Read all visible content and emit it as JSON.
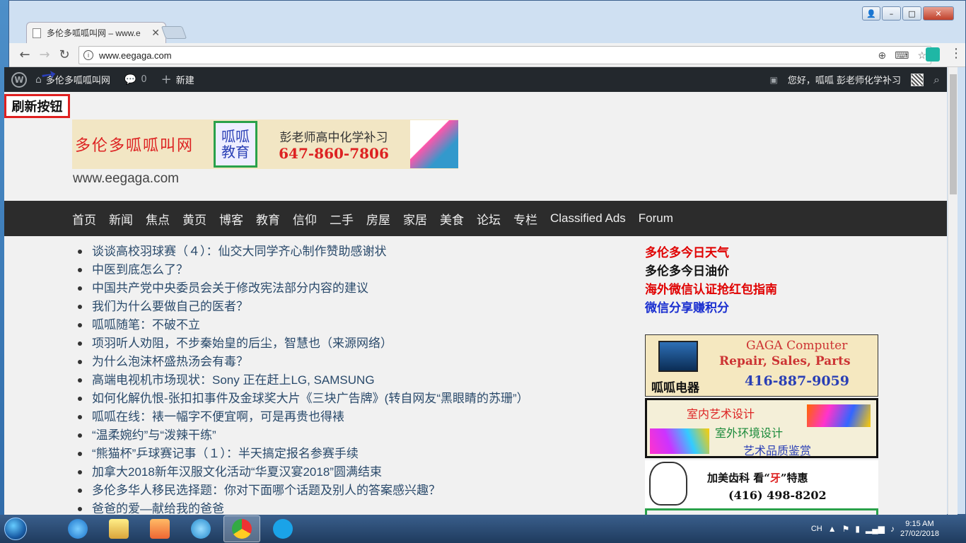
{
  "browser": {
    "tab_title": "多伦多呱呱叫网 – www.e",
    "url": "www.eegaga.com",
    "win_min": "–",
    "win_max": "□",
    "win_close": "✕"
  },
  "adminbar": {
    "site_name": "多伦多呱呱叫网",
    "comments_count": "0",
    "new_label": "新建",
    "greeting": "您好，呱呱 彭老师化学补习"
  },
  "annotation": {
    "refresh_label": "刷新按钮"
  },
  "banner": {
    "left_text": "多伦多呱呱叫网",
    "box_text": "呱呱教育",
    "line1": "彭老师高中化学补习",
    "phone": "647-860-7806"
  },
  "site_url": "www.eegaga.com",
  "mainnav": [
    "首页",
    "新闻",
    "焦点",
    "黄页",
    "博客",
    "教育",
    "信仰",
    "二手",
    "房屋",
    "家居",
    "美食",
    "论坛",
    "专栏",
    "Classified Ads",
    "Forum"
  ],
  "posts": [
    "谈谈高校羽球赛（４）：仙交大同学齐心制作赞助感谢状",
    "中医到底怎么了？",
    "中国共产党中央委员会关于修改宪法部分内容的建议",
    "我们为什么要做自己的医者？",
    "呱呱随笔：不破不立",
    "项羽听人劝阻，不步秦始皇的后尘，智慧也（来源网络）",
    "为什么泡沫杯盛热汤会有毒？",
    "高端电视机市场现状：Sony 正在赶上LG, SAMSUNG",
    "如何化解仇恨-张扣扣事件及金球奖大片《三块广告牌》(转自网友“黑眼睛的苏珊”）",
    "呱呱在线：裱一幅字不便宜啊，可是再贵也得裱",
    "“温柔婉约”与“泼辣干练”",
    "“熊猫杯”乒球赛记事（１）：半天搞定报名参赛手续",
    "加拿大2018新年汉服文化活动“华夏汉宴2018”圆满结束",
    "多伦多华人移民选择题：你对下面哪个话题及别人的答案感兴趣？",
    "爸爸的爱—献给我的爸爸"
  ],
  "sidelinks": [
    {
      "text": "多伦多今日天气",
      "color": "#e00000"
    },
    {
      "text": "多伦多今日油价",
      "color": "#111111"
    },
    {
      "text": "海外微信认证抢红包指南",
      "color": "#e00000"
    },
    {
      "text": "微信分享赚积分",
      "color": "#1a2fd0"
    }
  ],
  "ads": {
    "computer_l1": "GAGA Computer",
    "computer_l2": "Repair, Sales, Parts",
    "computer_l3": "呱呱电器",
    "computer_phone": "416-887-9059",
    "design_l1": "室内艺术设计",
    "design_l2": "室外环境设计",
    "design_l3": "艺术品质鉴赏",
    "dental_pre": "加美齿科 看“",
    "dental_mid": "牙",
    "dental_post": "”特惠",
    "dental_phone": "(416) 498-8202"
  },
  "taskbar": {
    "lang": "CH",
    "time": "9:15 AM",
    "date": "27/02/2018"
  }
}
